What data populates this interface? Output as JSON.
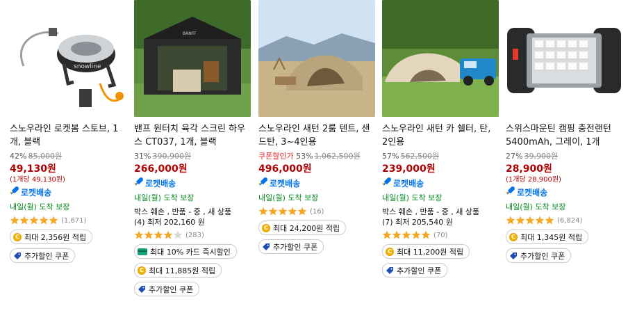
{
  "products": [
    {
      "title": "스노우라인 로켓봄 스토브, 1개, 블랙",
      "discount": "42%",
      "original_price": "85,000원",
      "price": "49,130원",
      "unit_price": "(1개당 49,130원)",
      "rocket": "로켓배송",
      "arrival": "내일(월) 도착 보장",
      "rating": 5,
      "review_count": "(1,671)",
      "chips": [
        {
          "icon": "coin-icon",
          "text": "최대 2,356원 적립"
        },
        {
          "icon": "coupon-tag-icon",
          "text": "추가할인 쿠폰"
        }
      ]
    },
    {
      "title": "밴프 원터치 육각 스크린 하우스 CT037, 1개, 블랙",
      "discount": "31%",
      "original_price": "390,900원",
      "price": "266,000원",
      "rocket": "로켓배송",
      "arrival": "내일(월) 도착 보장",
      "multi_line1": "박스 훼손 , 반품 - 중 , 새 상품",
      "multi_line2": "(4) 최저 202,160 원",
      "rating": 4,
      "review_count": "(283)",
      "chips": [
        {
          "icon": "card-icon",
          "text": "최대 10% 카드 즉시할인"
        },
        {
          "icon": "coin-icon",
          "text": "최대 11,885원 적립"
        },
        {
          "icon": "coupon-tag-icon",
          "text": "추가할인 쿠폰"
        }
      ]
    },
    {
      "title": "스노우라인 새턴 2룸 텐트, 샌드탄, 3~4인용",
      "coupon_label": "쿠폰할인가",
      "discount": "53%",
      "original_price": "1,062,500원",
      "price": "496,000원",
      "rocket": "로켓배송",
      "arrival": "내일(월) 도착 보장",
      "rating": 5,
      "review_count": "(16)",
      "chips": [
        {
          "icon": "coin-icon",
          "text": "최대 24,200원 적립"
        },
        {
          "icon": "coupon-tag-icon",
          "text": "추가할인 쿠폰"
        }
      ]
    },
    {
      "title": "스노우라인 새턴 카 쉘터, 탄, 2인용",
      "discount": "57%",
      "original_price": "562,500원",
      "price": "239,000원",
      "rocket": "로켓배송",
      "arrival": "내일(월) 도착 보장",
      "multi_line1": "박스 훼손 , 반품 - 중 , 새 상품",
      "multi_line2": "(7) 최저 205,540 원",
      "rating": 5,
      "review_count": "(70)",
      "chips": [
        {
          "icon": "coin-icon",
          "text": "최대 11,200원 적립"
        },
        {
          "icon": "coupon-tag-icon",
          "text": "추가할인 쿠폰"
        }
      ]
    },
    {
      "title": "스위스마운틴 캠핑 충전랜턴 5400mAh, 그레이, 1개",
      "discount": "27%",
      "original_price": "39,900원",
      "price": "28,900원",
      "unit_price": "(1개당 28,900원)",
      "rocket": "로켓배송",
      "arrival": "내일(월) 도착 보장",
      "rating": 5,
      "review_count": "(6,824)",
      "chips": [
        {
          "icon": "coin-icon",
          "text": "최대 1,345원 적립"
        },
        {
          "icon": "coupon-tag-icon",
          "text": "추가할인 쿠폰"
        }
      ]
    }
  ],
  "colors": {
    "price": "#ae0000",
    "rocket": "#0073e9",
    "arrival": "#00891a",
    "star": "#f5a623"
  }
}
